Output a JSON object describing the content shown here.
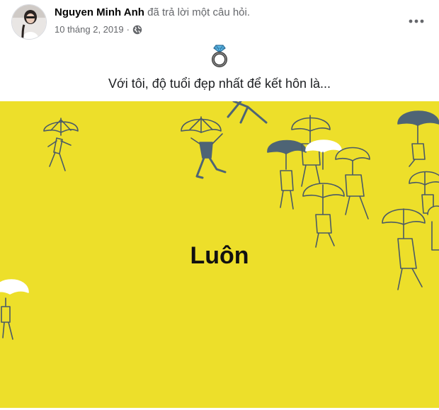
{
  "post": {
    "author_name": "Nguyen Minh Anh",
    "action_text": "đã trả lời một câu hỏi.",
    "date": "10 tháng 2, 2019",
    "separator": "·",
    "privacy_icon": "globe-icon",
    "more_icon": "more-options-icon"
  },
  "question": {
    "icon": "ring-icon",
    "text": "Với tôi, độ tuổi đẹp nhất để kết hôn là..."
  },
  "answer": {
    "text": "Luôn",
    "background_color": "#eddf2a",
    "illustration": "people-with-umbrellas"
  },
  "colors": {
    "figure_stroke": "#5a6b78",
    "dark_umbrella": "#4e6475",
    "light_umbrella": "#ffffff"
  }
}
